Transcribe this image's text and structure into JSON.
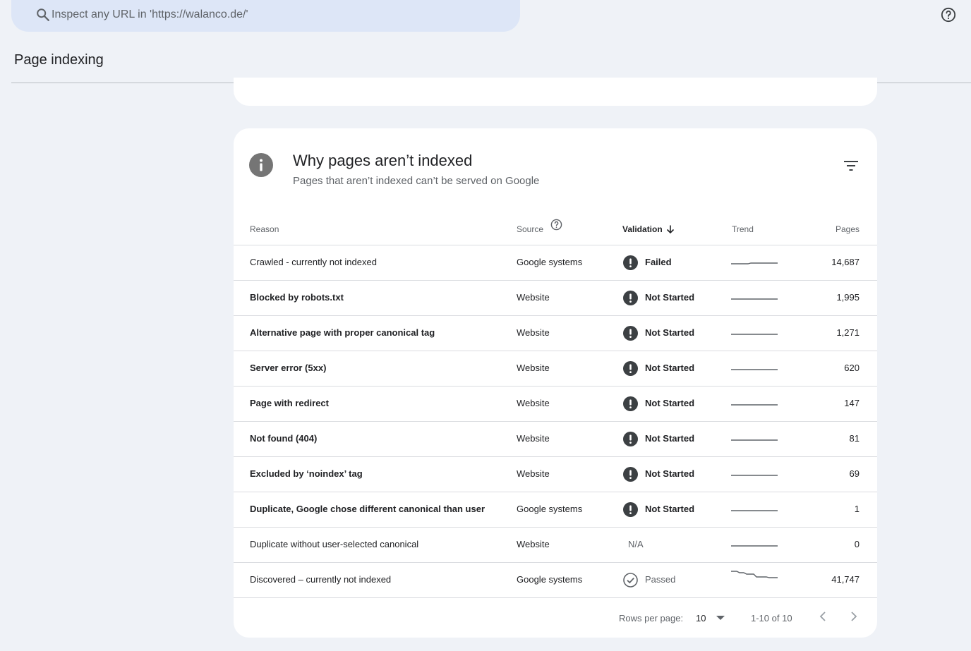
{
  "search": {
    "placeholder": "Inspect any URL in 'https://walanco.de/'"
  },
  "page_title": "Page indexing",
  "card": {
    "title": "Why pages aren’t indexed",
    "subtitle": "Pages that aren’t indexed can’t be served on Google"
  },
  "table": {
    "headers": {
      "reason": "Reason",
      "source": "Source",
      "validation": "Validation",
      "trend": "Trend",
      "pages": "Pages"
    },
    "rows": [
      {
        "reason": "Crawled - currently not indexed",
        "source": "Google systems",
        "validation": "Failed",
        "pages": "14,687"
      },
      {
        "reason": "Blocked by robots.txt",
        "source": "Website",
        "validation": "Not Started",
        "pages": "1,995"
      },
      {
        "reason": "Alternative page with proper canonical tag",
        "source": "Website",
        "validation": "Not Started",
        "pages": "1,271"
      },
      {
        "reason": "Server error (5xx)",
        "source": "Website",
        "validation": "Not Started",
        "pages": "620"
      },
      {
        "reason": "Page with redirect",
        "source": "Website",
        "validation": "Not Started",
        "pages": "147"
      },
      {
        "reason": "Not found (404)",
        "source": "Website",
        "validation": "Not Started",
        "pages": "81"
      },
      {
        "reason": "Excluded by ‘noindex’ tag",
        "source": "Website",
        "validation": "Not Started",
        "pages": "69"
      },
      {
        "reason": "Duplicate, Google chose different canonical than user",
        "source": "Google systems",
        "validation": "Not Started",
        "pages": "1"
      },
      {
        "reason": "Duplicate without user-selected canonical",
        "source": "Website",
        "validation": "N/A",
        "pages": "0"
      },
      {
        "reason": "Discovered – currently not indexed",
        "source": "Google systems",
        "validation": "Passed",
        "pages": "41,747"
      }
    ]
  },
  "footer": {
    "rows_per_page_label": "Rows per page:",
    "rows_per_page_value": "10",
    "range": "1-10 of 10"
  },
  "colors": {
    "background": "#eff2f7",
    "search_bg": "#dde6f7",
    "icon_dark": "#3c4043"
  }
}
